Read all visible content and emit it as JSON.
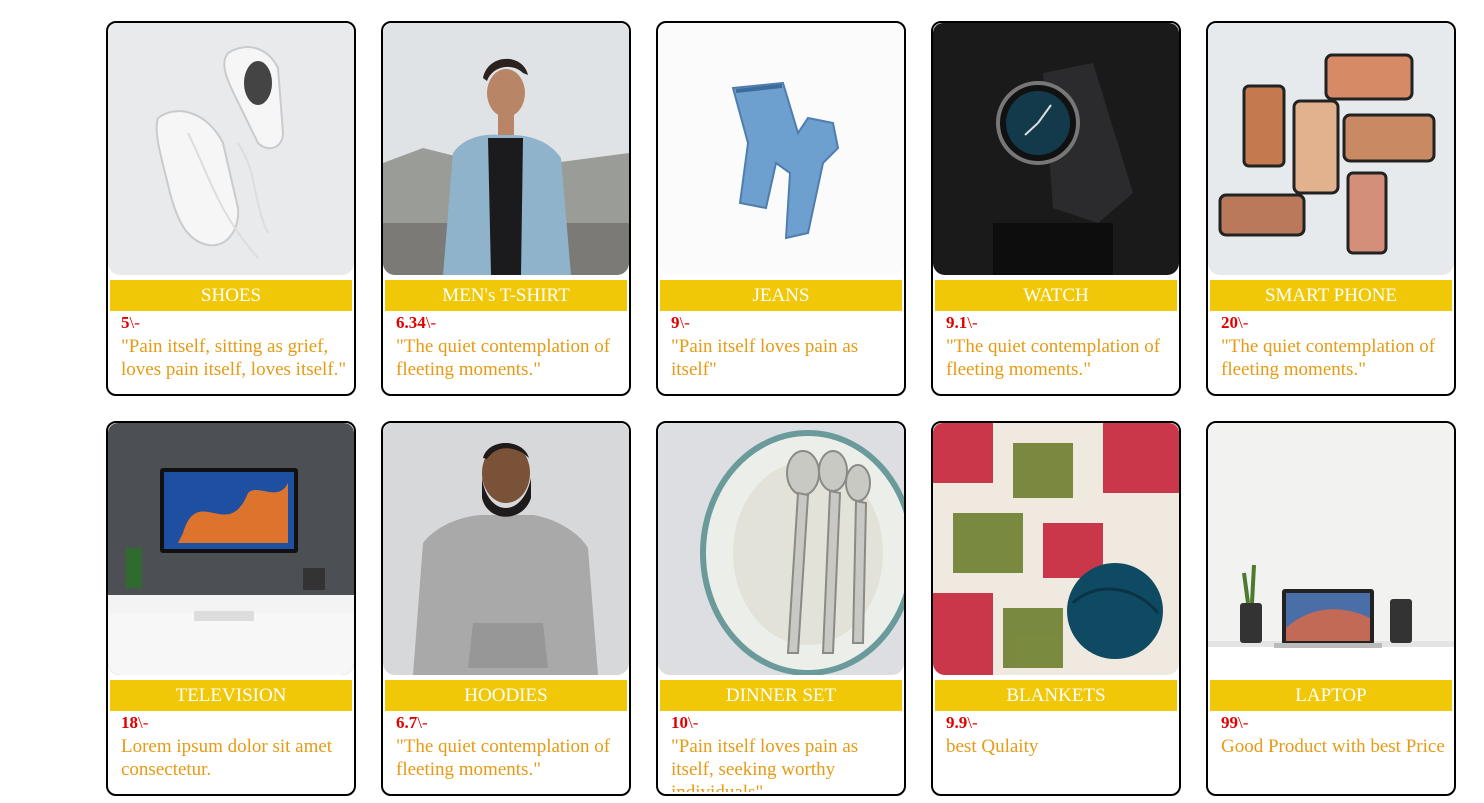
{
  "products": [
    {
      "name": "SHOES",
      "price": "5",
      "price_suffix": "\\-",
      "description": "\"Pain itself, sitting as grief, loves pain itself, loves itself.\"",
      "image": "white-sneakers-photo"
    },
    {
      "name": "MEN's T-SHIRT",
      "price": "6.34",
      "price_suffix": "\\-",
      "description": "\"The quiet contemplation of fleeting moments.\"",
      "image": "man-denim-jacket-photo"
    },
    {
      "name": "JEANS",
      "price": "9",
      "price_suffix": "\\-",
      "description": "\"Pain itself loves pain as itself\"",
      "image": "blue-jeans-photo"
    },
    {
      "name": "WATCH",
      "price": "9.1",
      "price_suffix": "\\-",
      "description": "\"The quiet contemplation of fleeting moments.\"",
      "image": "wrist-watch-photo"
    },
    {
      "name": "SMART PHONE",
      "price": "20",
      "price_suffix": "\\-",
      "description": "\"The quiet contemplation of fleeting moments.\"",
      "image": "smartphones-photo"
    },
    {
      "name": "TELEVISION",
      "price": "18",
      "price_suffix": "\\-",
      "description": "Lorem ipsum dolor sit amet consectetur.",
      "image": "desk-monitor-photo"
    },
    {
      "name": "HOODIES",
      "price": "6.7",
      "price_suffix": "\\-",
      "description": "\"The quiet contemplation of fleeting moments.\"",
      "image": "man-grey-hoodie-photo"
    },
    {
      "name": "DINNER SET",
      "price": "10",
      "price_suffix": "\\-",
      "description": "\"Pain itself loves pain as itself, seeking worthy individuals\"",
      "image": "silver-spoons-plate-photo"
    },
    {
      "name": "BLANKETS",
      "price": "9.9",
      "price_suffix": "\\-",
      "description": "best Qulaity",
      "image": "crochet-blanket-photo"
    },
    {
      "name": "LAPTOP",
      "price": "99",
      "price_suffix": "\\-",
      "description": "Good Product with best Price",
      "image": "laptop-desk-photo"
    }
  ],
  "colors": {
    "title_bar": "#f0c808",
    "price": "#e00000",
    "description": "#e79a14",
    "border": "#000000"
  }
}
